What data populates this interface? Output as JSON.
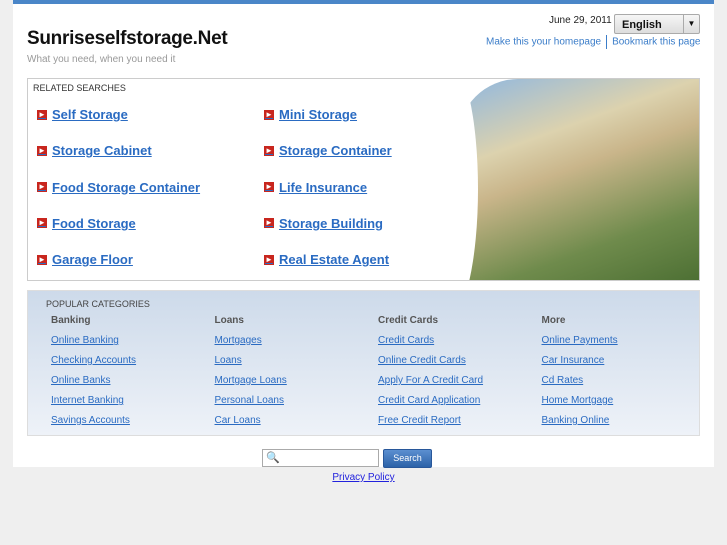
{
  "header": {
    "site_title": "Sunriseselfstorage.Net",
    "tagline": "What you need, when you need it",
    "date": "June 29, 2011",
    "language": "English",
    "make_homepage": "Make this your homepage",
    "bookmark": "Bookmark this page"
  },
  "related": {
    "heading": "RELATED SEARCHES",
    "items": [
      "Self Storage",
      "Mini Storage",
      "Storage Cabinet",
      "Storage Container",
      "Food Storage Container",
      "Life Insurance",
      "Food Storage",
      "Storage Building",
      "Garage Floor",
      "Real Estate Agent"
    ]
  },
  "popular": {
    "heading": "POPULAR CATEGORIES",
    "columns": [
      {
        "title": "Banking",
        "links": [
          "Online Banking",
          "Checking Accounts",
          "Online Banks",
          "Internet Banking",
          "Savings Accounts"
        ]
      },
      {
        "title": "Loans",
        "links": [
          "Mortgages",
          "Loans",
          "Mortgage Loans",
          "Personal Loans",
          "Car Loans"
        ]
      },
      {
        "title": "Credit Cards",
        "links": [
          "Credit Cards",
          "Online Credit Cards",
          "Apply For A Credit Card",
          "Credit Card Application",
          "Free Credit Report"
        ]
      },
      {
        "title": "More",
        "links": [
          "Online Payments",
          "Car Insurance",
          "Cd Rates",
          "Home Mortgage",
          "Banking Online"
        ]
      }
    ]
  },
  "search": {
    "button": "Search",
    "value": ""
  },
  "footer": {
    "privacy": "Privacy Policy"
  }
}
